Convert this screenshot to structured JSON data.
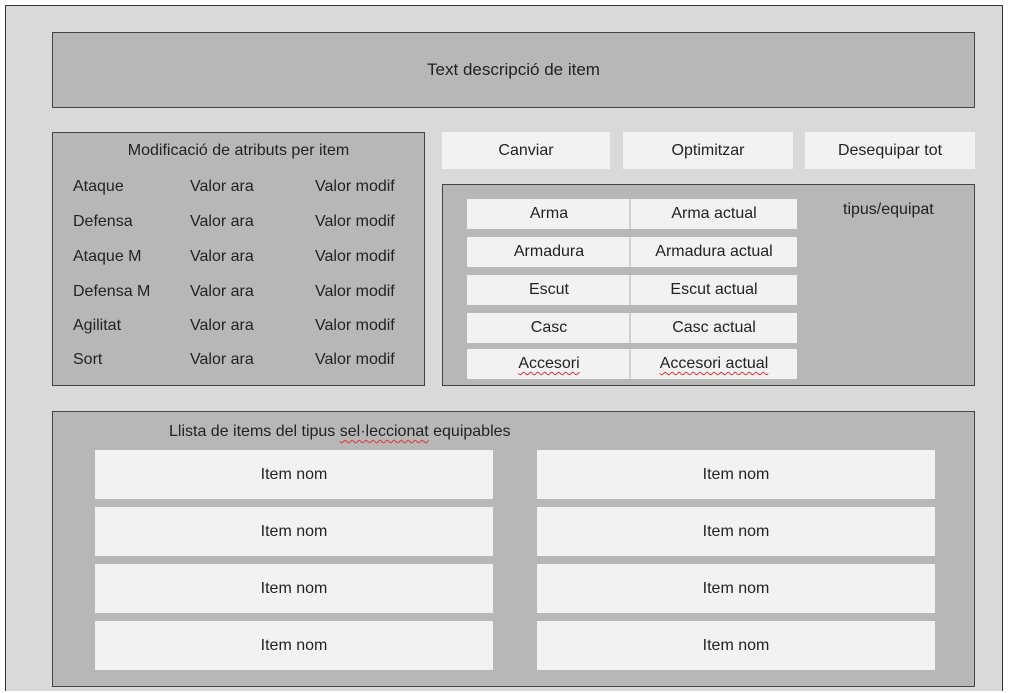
{
  "description": {
    "text": "Text descripció de item"
  },
  "attributes": {
    "title": "Modificació de atributs per item",
    "rows": [
      {
        "name": "Ataque",
        "current": "Valor ara",
        "modified": "Valor modif"
      },
      {
        "name": "Defensa",
        "current": "Valor ara",
        "modified": "Valor modif"
      },
      {
        "name": "Ataque M",
        "current": "Valor ara",
        "modified": "Valor modif"
      },
      {
        "name": "Defensa M",
        "current": "Valor ara",
        "modified": "Valor modif"
      },
      {
        "name": "Agilitat",
        "current": "Valor ara",
        "modified": "Valor modif"
      },
      {
        "name": "Sort",
        "current": "Valor ara",
        "modified": "Valor modif"
      }
    ]
  },
  "actions": {
    "change": "Canviar",
    "optimize": "Optimitzar",
    "unequip_all": "Desequipar tot"
  },
  "equipment": {
    "type_label": "tipus/equipat",
    "slots": [
      {
        "name": "Arma",
        "current": "Arma actual"
      },
      {
        "name": "Armadura",
        "current": "Armadura actual"
      },
      {
        "name": "Escut",
        "current": "Escut actual"
      },
      {
        "name": "Casc",
        "current": "Casc actual"
      },
      {
        "name": "Accesori",
        "current": "Accesori actual"
      }
    ]
  },
  "item_list": {
    "title_before": "Llista de items del tipus ",
    "title_misspelled": "sel·leccionat",
    "title_after": " equipables",
    "items": [
      "Item nom",
      "Item nom",
      "Item nom",
      "Item nom",
      "Item nom",
      "Item nom",
      "Item nom",
      "Item nom"
    ]
  }
}
